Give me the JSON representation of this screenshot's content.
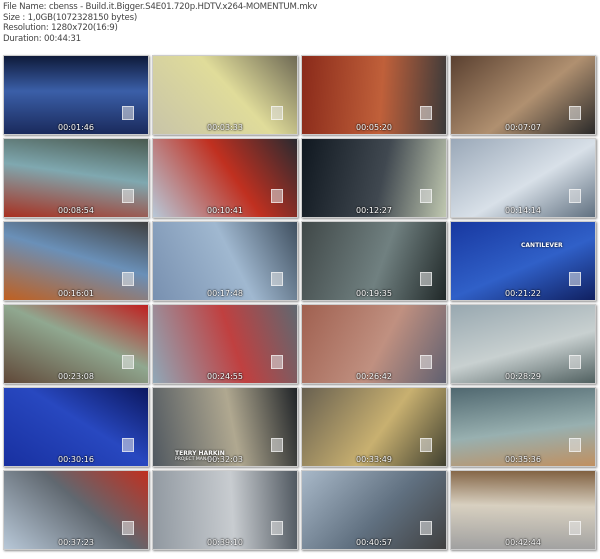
{
  "info": {
    "file_name": "File Name: cbenss - Build.it.Bigger.S4E01.720p.HDTV.x264-MOMENTUM.mkv",
    "size": "Size : 1,0GB(1072328150 bytes)",
    "resolution": "Resolution: 1280x720(16:9)",
    "duration": "Duration: 00:44:31"
  },
  "thumbnails": [
    {
      "time": "00:01:46",
      "colors": [
        "#1a2a5c",
        "#3b5fa8",
        "#0e1a3a"
      ]
    },
    {
      "time": "00:03:33",
      "colors": [
        "#c8c4a8",
        "#e0dc9a",
        "#6f6a55"
      ]
    },
    {
      "time": "00:05:20",
      "colors": [
        "#8a2a1a",
        "#c0603a",
        "#3a3a3a"
      ]
    },
    {
      "time": "00:07:07",
      "colors": [
        "#5a4030",
        "#b09070",
        "#2a2a2a"
      ]
    },
    {
      "time": "00:08:54",
      "colors": [
        "#a83020",
        "#7fa8b0",
        "#4a5a50"
      ]
    },
    {
      "time": "00:10:41",
      "colors": [
        "#b8c8d8",
        "#c03020",
        "#2a2a30"
      ]
    },
    {
      "time": "00:12:27",
      "colors": [
        "#101820",
        "#404850",
        "#c0c8b0"
      ]
    },
    {
      "time": "00:14:14",
      "colors": [
        "#9aa8b8",
        "#d8e0e8",
        "#607080"
      ]
    },
    {
      "time": "00:16:01",
      "colors": [
        "#c06020",
        "#6a90b8",
        "#404040"
      ]
    },
    {
      "time": "00:17:48",
      "colors": [
        "#7890b0",
        "#a0b8d0",
        "#405060"
      ]
    },
    {
      "time": "00:19:35",
      "colors": [
        "#404848",
        "#708080",
        "#202828"
      ]
    },
    {
      "time": "00:21:22",
      "colors": [
        "#1838a0",
        "#3060c8",
        "#102060"
      ],
      "caption": "CANTILEVER"
    },
    {
      "time": "00:23:08",
      "colors": [
        "#604838",
        "#90a890",
        "#c02020"
      ]
    },
    {
      "time": "00:24:55",
      "colors": [
        "#90a8b8",
        "#c04040",
        "#606870"
      ]
    },
    {
      "time": "00:26:42",
      "colors": [
        "#a06050",
        "#c09080",
        "#606070"
      ]
    },
    {
      "time": "00:28:29",
      "colors": [
        "#98a8b0",
        "#c8d0d0",
        "#506060"
      ]
    },
    {
      "time": "00:30:16",
      "colors": [
        "#1830a0",
        "#2848c0",
        "#0c1860"
      ]
    },
    {
      "time": "00:32:03",
      "colors": [
        "#505860",
        "#b0a890",
        "#202428"
      ],
      "caption": "TERRY HARKIN",
      "caption_sub": "PROJECT MANAGER"
    },
    {
      "time": "00:33:49",
      "colors": [
        "#686050",
        "#c8b070",
        "#404030"
      ]
    },
    {
      "time": "00:35:36",
      "colors": [
        "#506870",
        "#98b0b0",
        "#c09060"
      ]
    },
    {
      "time": "00:37:23",
      "colors": [
        "#b8c8d8",
        "#606870",
        "#c03020"
      ]
    },
    {
      "time": "00:39:10",
      "colors": [
        "#9098a0",
        "#c8ccd0",
        "#505860"
      ]
    },
    {
      "time": "00:40:57",
      "colors": [
        "#a8b8c8",
        "#607080",
        "#404040"
      ]
    },
    {
      "time": "00:42:44",
      "colors": [
        "#a0a0a0",
        "#d8d0c0",
        "#806040"
      ]
    }
  ]
}
